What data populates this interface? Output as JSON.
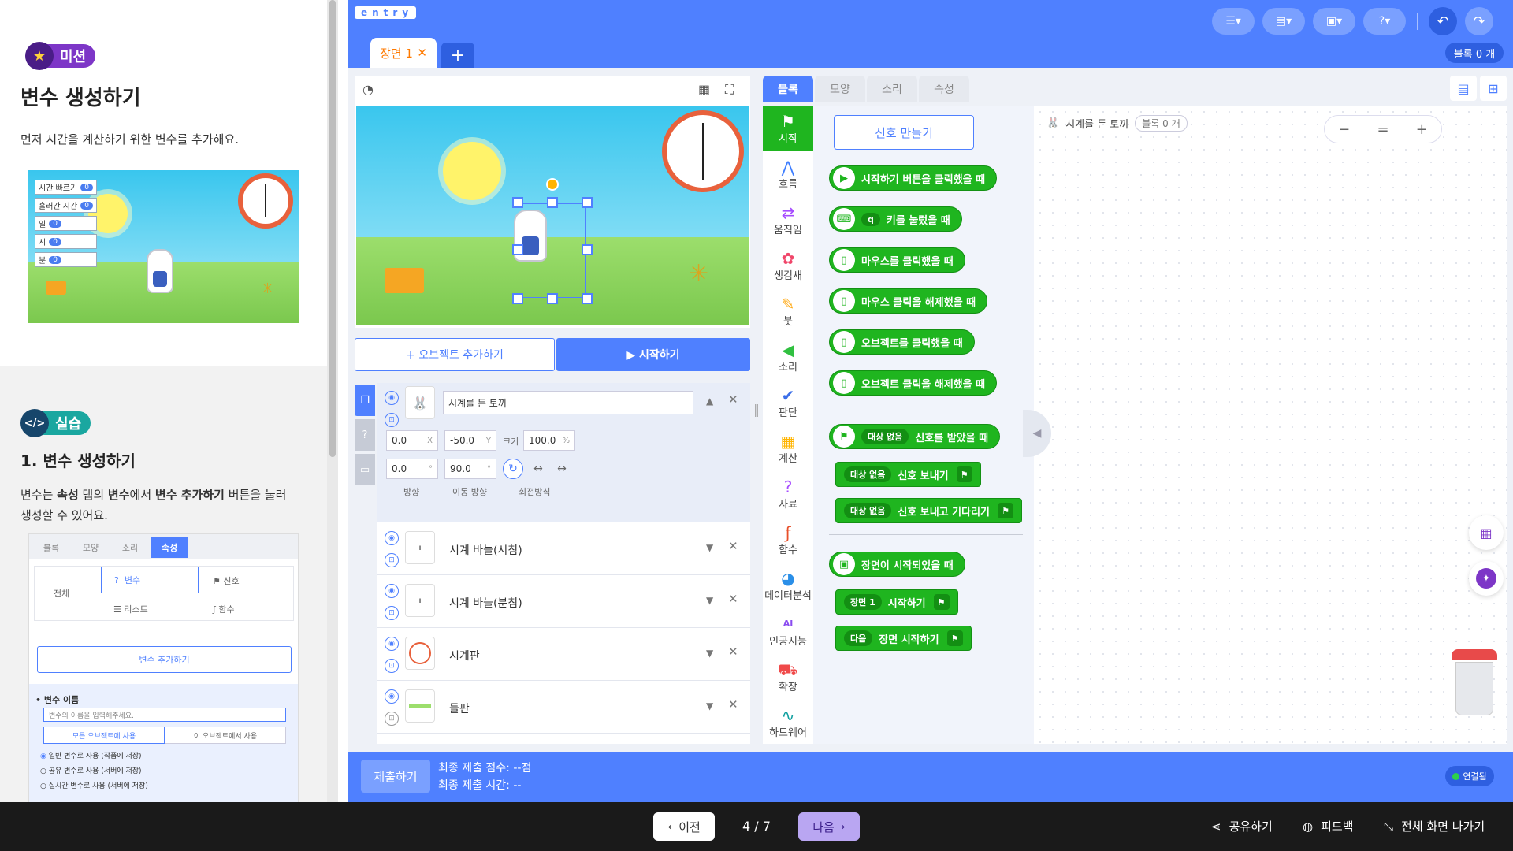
{
  "mission": {
    "badge": "미션",
    "title": "변수 생성하기",
    "description": "먼저 시간을 계산하기 위한 변수를 추가해요.",
    "illustration_vars": [
      {
        "label": "시간 빠르기",
        "value": "0"
      },
      {
        "label": "흘러간 시간",
        "value": "0"
      },
      {
        "label": "일",
        "value": "0"
      },
      {
        "label": "시",
        "value": "0"
      },
      {
        "label": "분",
        "value": "0"
      }
    ]
  },
  "practice": {
    "badge": "실습",
    "title": "1. 변수 생성하기",
    "desc_1": "변수는 ",
    "desc_b1": "속성",
    "desc_2": " 탭의 ",
    "desc_b2": "변수",
    "desc_3": "에서 ",
    "desc_b3": "변수 추가하기",
    "desc_4": " 버튼을 눌러",
    "desc_5": "생성할 수 있어요.",
    "mini": {
      "tabs": [
        "블록",
        "모양",
        "소리",
        "속성"
      ],
      "all_label": "전체",
      "variable": "변수",
      "signal": "신호",
      "list": "리스트",
      "function": "함수",
      "add_variable": "변수 추가하기",
      "var_name_label": "변수 이름",
      "var_name_placeholder": "변수의 이름을 입력해주세요.",
      "use_all": "모든 오브젝트에 사용",
      "use_this": "이 오브젝트에서 사용",
      "options": [
        "일반 변수로 사용 (작품에 저장)",
        "공유 변수로 사용 (서버에 저장)",
        "실시간 변수로 사용 (서버에 저장)"
      ]
    }
  },
  "editor": {
    "logo": "entry",
    "scene_tab": "장면 1",
    "block_count": "블록 0 개",
    "add_object": "+ 오브젝트 추가하기",
    "start": "▶ 시작하기",
    "selected_object": {
      "name": "시계를 든 토끼",
      "x": "0.0",
      "y": "-50.0",
      "size_label": "크기",
      "size": "100.0",
      "direction": "0.0",
      "move_direction": "90.0",
      "dir_label": "방향",
      "move_dir_label": "이동 방향",
      "rotation_label": "회전방식"
    },
    "objects": [
      "시계 바늘(시침)",
      "시계 바늘(분침)",
      "시계판",
      "들판"
    ],
    "block_tabs": [
      "블록",
      "모양",
      "소리",
      "속성"
    ],
    "categories": [
      {
        "label": "시작",
        "icon": "flag-icon",
        "glyph": "⚑",
        "color": "#ffffff"
      },
      {
        "label": "흐름",
        "icon": "flow-icon",
        "glyph": "⋀",
        "color": "#3b7cff"
      },
      {
        "label": "움직임",
        "icon": "move-icon",
        "glyph": "⇄",
        "color": "#a64cff"
      },
      {
        "label": "생김새",
        "icon": "looks-icon",
        "glyph": "✿",
        "color": "#f0466a"
      },
      {
        "label": "붓",
        "icon": "brush-icon",
        "glyph": "✎",
        "color": "#ffab19"
      },
      {
        "label": "소리",
        "icon": "sound-icon",
        "glyph": "◀",
        "color": "#30c040"
      },
      {
        "label": "판단",
        "icon": "judge-icon",
        "glyph": "✔",
        "color": "#3b6ee8"
      },
      {
        "label": "계산",
        "icon": "calc-icon",
        "glyph": "▦",
        "color": "#ffb400"
      },
      {
        "label": "자료",
        "icon": "data-icon",
        "glyph": "?",
        "color": "#a64cff"
      },
      {
        "label": "함수",
        "icon": "function-icon",
        "glyph": "ƒ",
        "color": "#e8502a"
      },
      {
        "label": "데이터분석",
        "icon": "chart-icon",
        "glyph": "◕",
        "color": "#2a8fe8"
      },
      {
        "label": "인공지능",
        "icon": "ai-icon",
        "glyph": "AI",
        "color": "#8a4cf0"
      },
      {
        "label": "확장",
        "icon": "extension-icon",
        "glyph": "⛟",
        "color": "#f04a4a"
      },
      {
        "label": "하드웨어",
        "icon": "hardware-icon",
        "glyph": "∿",
        "color": "#10a0a0"
      }
    ],
    "make_signal": "신호 만들기",
    "blocks": {
      "b1": "시작하기 버튼을 클릭했을 때",
      "b2_key": "q",
      "b2": "키를 눌렀을 때",
      "b3": "마우스를 클릭했을 때",
      "b4": "마우스 클릭을 해제했을 때",
      "b5": "오브젝트를 클릭했을 때",
      "b6": "오브젝트 클릭을 해제했을 때",
      "b7_dd": "대상 없음",
      "b7": "신호를 받았을 때",
      "b8_dd": "대상 없음",
      "b8": "신호 보내기",
      "b9_dd": "대상 없음",
      "b9": "신호 보내고 기다리기",
      "b10": "장면이 시작되었을 때",
      "b11_dd": "장면 1",
      "b11": "시작하기",
      "b12_dd": "다음",
      "b12": "장면 시작하기"
    },
    "canvas_object": "시계를 든 토끼",
    "canvas_block_count": "블록 0 개",
    "submit": "제출하기",
    "final_score": "최종 제출 점수: --점",
    "final_time": "최종 제출 시간: --",
    "connected": "연결됨"
  },
  "bottom": {
    "prev": "이전",
    "page": "4 / 7",
    "next": "다음",
    "share": "공유하기",
    "feedback": "피드백",
    "fullscreen_exit": "전체 화면 나가기"
  },
  "colors": {
    "accent": "#4f80ff",
    "block_green": "#1fb51f",
    "mission_purple": "#7d36c7",
    "practice_teal": "#1aa7a0"
  }
}
